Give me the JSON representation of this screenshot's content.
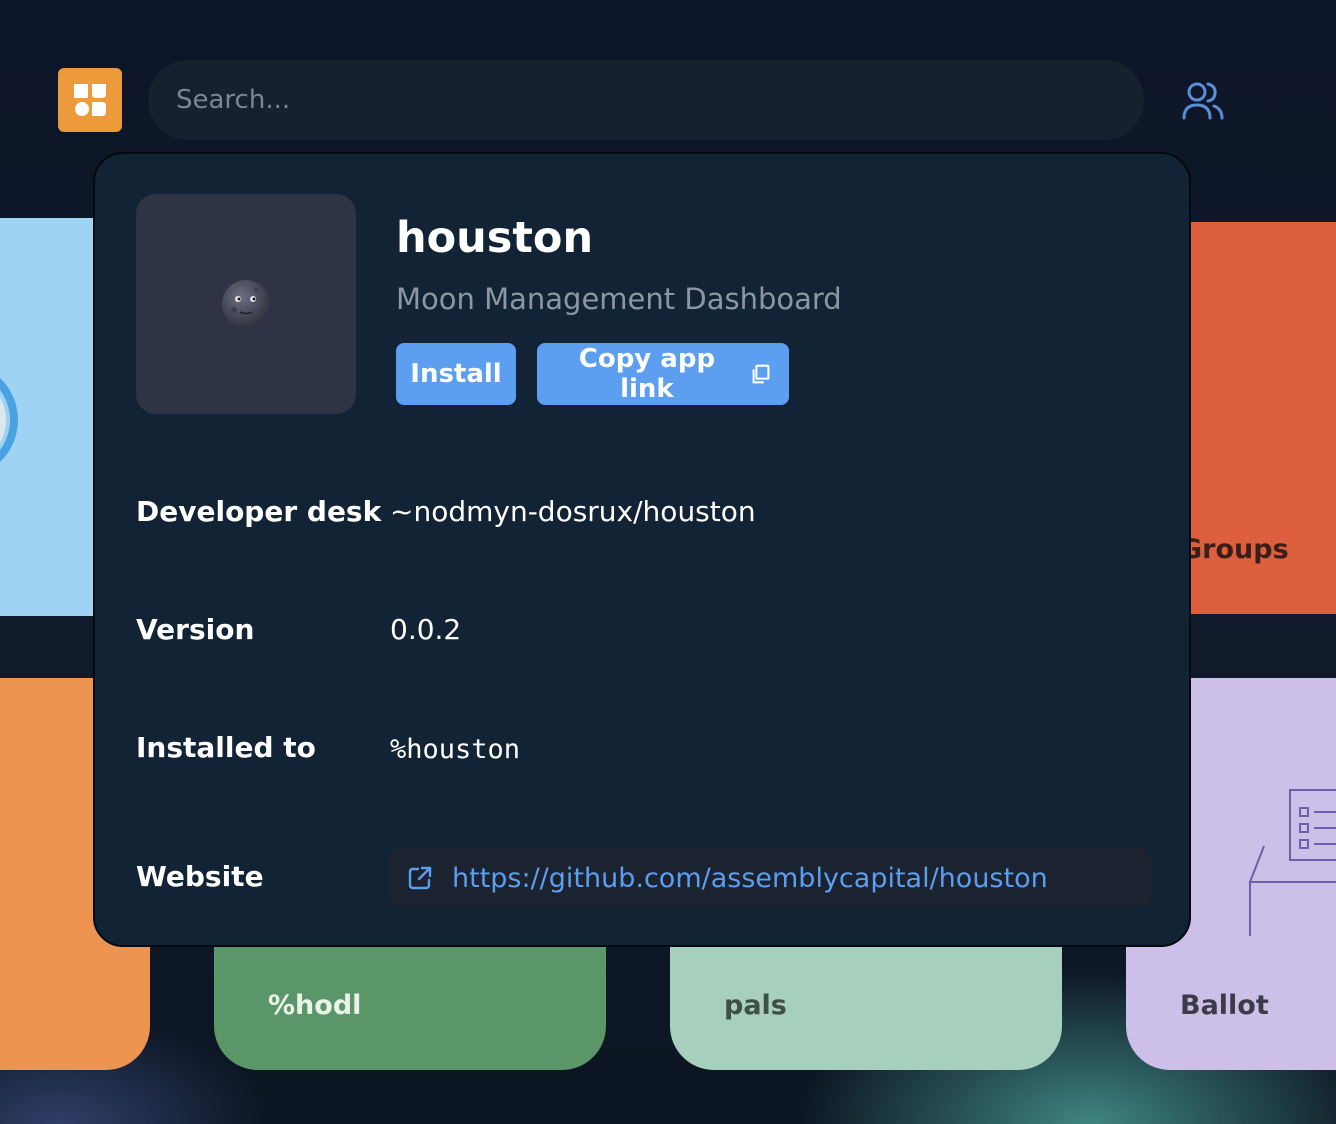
{
  "search": {
    "placeholder": "Search..."
  },
  "tiles": {
    "groups": "Groups",
    "hodl": "%hodl",
    "pals": "pals",
    "ballot": "Ballot"
  },
  "app": {
    "title": "houston",
    "subtitle": "Moon Management Dashboard",
    "icon": "moon-face-icon",
    "install_label": "Install",
    "copy_link_label": "Copy app link"
  },
  "details": {
    "developer_desk_label": "Developer desk",
    "developer_desk_value": "~nodmyn-dosrux/houston",
    "version_label": "Version",
    "version_value": "0.0.2",
    "installed_to_label": "Installed to",
    "installed_to_value": "%houston",
    "website_label": "Website",
    "website_value": "https://github.com/assemblycapital/houston"
  },
  "colors": {
    "accent": "#5c9ef0",
    "logo": "#ed9a3a",
    "modal_bg": "#132336"
  }
}
